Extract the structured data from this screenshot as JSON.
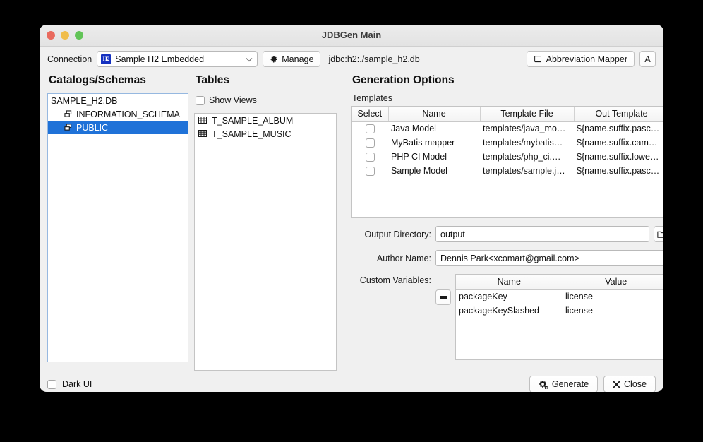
{
  "window": {
    "title": "JDBGen Main",
    "traffic_lights": [
      "close",
      "minimize",
      "zoom"
    ]
  },
  "toolbar": {
    "connection_label": "Connection",
    "connection_value": "Sample H2 Embedded",
    "connection_icon_text": "H2",
    "manage_label": "Manage",
    "jdbc_url": "jdbc:h2:./sample_h2.db",
    "abbreviation_mapper_label": "Abbreviation Mapper",
    "font_button_label": "A"
  },
  "catalogs": {
    "title": "Catalogs/Schemas",
    "nodes": [
      {
        "label": "SAMPLE_H2.DB",
        "type": "database",
        "indent": 0,
        "selected": false
      },
      {
        "label": "INFORMATION_SCHEMA",
        "type": "schema",
        "indent": 1,
        "selected": false
      },
      {
        "label": "PUBLIC",
        "type": "schema",
        "indent": 1,
        "selected": true
      }
    ]
  },
  "tables": {
    "title": "Tables",
    "show_views_label": "Show Views",
    "show_views_checked": false,
    "items": [
      {
        "label": "T_SAMPLE_ALBUM"
      },
      {
        "label": "T_SAMPLE_MUSIC"
      }
    ]
  },
  "generation": {
    "title": "Generation Options",
    "templates_label": "Templates",
    "templates_columns": [
      "Select",
      "Name",
      "Template File",
      "Out Template",
      ""
    ],
    "templates_rows": [
      {
        "selected": false,
        "name": "Java Model",
        "file": "templates/java_mo…",
        "out": "${name.suffix.pasc…"
      },
      {
        "selected": false,
        "name": "MyBatis mapper",
        "file": "templates/mybatis…",
        "out": "${name.suffix.cam…"
      },
      {
        "selected": false,
        "name": "PHP CI Model",
        "file": "templates/php_ci.…",
        "out": "${name.suffix.lowe…"
      },
      {
        "selected": false,
        "name": "Sample Model",
        "file": "templates/sample.j…",
        "out": "${name.suffix.pasc…"
      }
    ],
    "output_directory_label": "Output Directory:",
    "output_directory_value": "output",
    "author_name_label": "Author Name:",
    "author_name_value": "Dennis Park<xcomart@gmail.com>",
    "custom_variables_label": "Custom Variables:",
    "custom_variables_columns": [
      "Name",
      "Value"
    ],
    "custom_variables_rows": [
      {
        "name": "packageKey",
        "value": "license"
      },
      {
        "name": "packageKeySlashed",
        "value": "license"
      }
    ]
  },
  "footer": {
    "dark_ui_label": "Dark UI",
    "dark_ui_checked": false,
    "generate_label": "Generate",
    "close_label": "Close"
  },
  "colors": {
    "selection_blue": "#1f72d8",
    "window_bg": "#f0f0f0",
    "h2_logo_blue": "#1430c0",
    "desktop_bg": "#000000"
  }
}
